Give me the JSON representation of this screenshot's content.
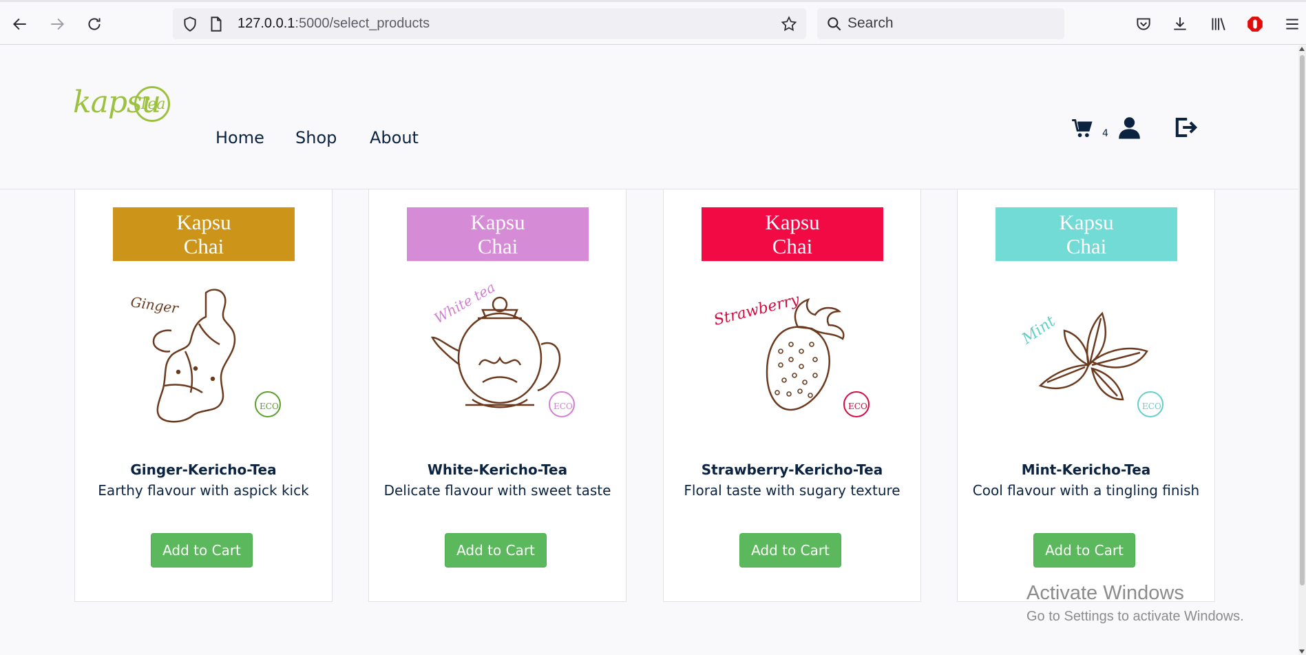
{
  "browser": {
    "url_host": "127.0.0.1",
    "url_rest": ":5000/select_products",
    "search_placeholder": "Search"
  },
  "site": {
    "logo_text": "kapsu",
    "logo_badge": "Tea",
    "nav": [
      "Home",
      "Shop",
      "About"
    ],
    "cart_count": "4"
  },
  "products": [
    {
      "banner_line1": "Kapsu",
      "banner_line2": "Chai",
      "banner_color": "#cc9419",
      "illustration_label": "Ginger",
      "illustration_icon": "ginger-root-illustration",
      "accent": "#5a9e2b",
      "name": "Ginger-Kericho-Tea",
      "description": "Earthy flavour with aspick kick",
      "button": "Add to Cart"
    },
    {
      "banner_line1": "Kapsu",
      "banner_line2": "Chai",
      "banner_color": "#d68bd6",
      "illustration_label": "White tea",
      "illustration_icon": "teapot-illustration",
      "accent": "#d27fd2",
      "name": "White-Kericho-Tea",
      "description": "Delicate flavour with sweet taste",
      "button": "Add to Cart"
    },
    {
      "banner_line1": "Kapsu",
      "banner_line2": "Chai",
      "banner_color": "#f20a45",
      "illustration_label": "Strawberry",
      "illustration_icon": "strawberry-illustration",
      "accent": "#d7083e",
      "name": "Strawberry-Kericho-Tea",
      "description": "Floral taste with sugary texture",
      "button": "Add to Cart"
    },
    {
      "banner_line1": "Kapsu",
      "banner_line2": "Chai",
      "banner_color": "#72dbd6",
      "illustration_label": "Mint",
      "illustration_icon": "mint-leaves-illustration",
      "accent": "#62cfcb",
      "name": "Mint-Kericho-Tea",
      "description": "Cool flavour with a tingling finish",
      "button": "Add to Cart"
    }
  ],
  "eco_badge": "ECO",
  "watermark": {
    "line1": "Activate Windows",
    "line2": "Go to Settings to activate Windows."
  },
  "colors": {
    "navy": "#0c2340",
    "button_green": "#5cb85c",
    "logo_green": "#9cc13f"
  }
}
